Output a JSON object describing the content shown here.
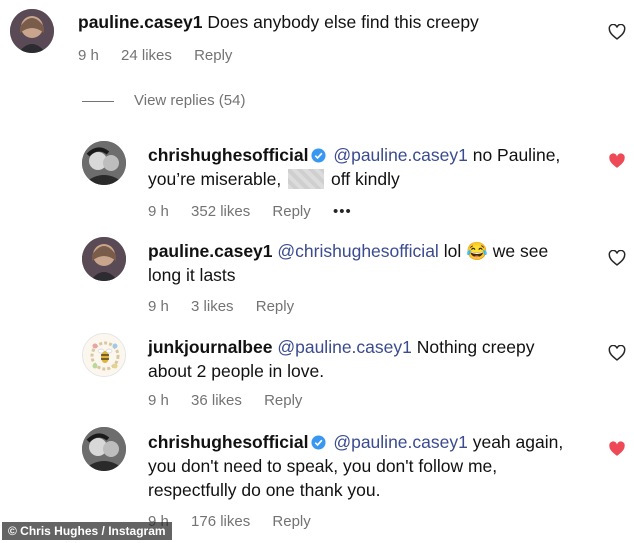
{
  "comments": [
    {
      "username": "pauline.casey1",
      "verified": false,
      "text_plain": "Does anybody else find this creepy",
      "time": "9 h",
      "likes": "24 likes",
      "reply": "Reply",
      "liked": false
    },
    {
      "username": "chrishughesofficial",
      "verified": true,
      "mention": "@pauline.casey1",
      "text_a": "no Pauline,",
      "text_b": "you’re miserable,",
      "text_c": "off kindly",
      "time": "9 h",
      "likes": "352 likes",
      "reply": "Reply",
      "more": "•••",
      "liked": true
    },
    {
      "username": "pauline.casey1",
      "verified": false,
      "mention": "@chrishughesofficial",
      "text_a": "lol 😂 we see",
      "text_b": "long it lasts",
      "time": "9 h",
      "likes": "3 likes",
      "reply": "Reply",
      "liked": false
    },
    {
      "username": "junkjournalbee",
      "verified": false,
      "mention": "@pauline.casey1",
      "text_a": "Nothing creepy",
      "text_b": "about 2 people in love.",
      "time": "9 h",
      "likes": "36 likes",
      "reply": "Reply",
      "liked": false
    },
    {
      "username": "chrishughesofficial",
      "verified": true,
      "mention": "@pauline.casey1",
      "text_a": "yeah again,",
      "text_b": "you don't need to speak, you don't follow me,",
      "text_c": "respectfully do one thank you.",
      "time": "9 h",
      "likes": "176 likes",
      "reply": "Reply",
      "liked": true
    }
  ],
  "view_replies": "View replies (54)",
  "credit": "© Chris Hughes / Instagram",
  "colors": {
    "heart_liked": "#ed4956",
    "heart_outline": "#262626",
    "mention": "#3a4b8f",
    "meta": "#737373"
  },
  "icons": {
    "like": "heart-icon",
    "verified": "verified-badge-icon"
  }
}
